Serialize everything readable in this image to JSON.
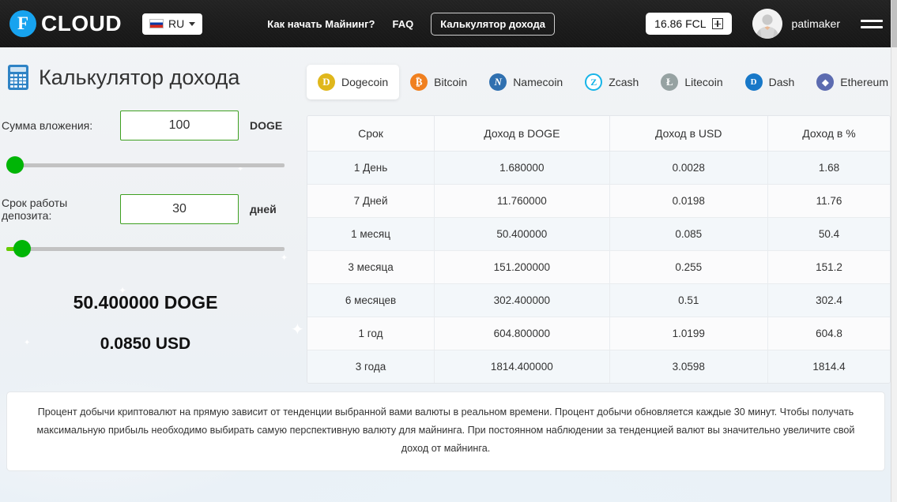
{
  "header": {
    "logo_letter": "F",
    "logo_text": "CLOUD",
    "lang": "RU",
    "lang_icon": "flag-ru-icon",
    "nav": [
      {
        "label": "Как начать Майнинг?",
        "type": "link"
      },
      {
        "label": "FAQ",
        "type": "link"
      },
      {
        "label": "Калькулятор дохода",
        "type": "button"
      }
    ],
    "balance": "16.86 FCL",
    "balance_add_icon": "plus-square-icon",
    "username": "patimaker",
    "avatar_icon": "user-avatar-icon",
    "menu_icon": "hamburger-menu-icon"
  },
  "calculator": {
    "icon": "calculator-icon",
    "title": "Калькулятор дохода",
    "amount": {
      "label": "Сумма вложения:",
      "value": "100",
      "unit": "DOGE",
      "slider_percent": 0
    },
    "term": {
      "label": "Срок работы депозита:",
      "value": "30",
      "unit": "дней",
      "slider_percent": 3
    },
    "result_coin": "50.400000 DOGE",
    "result_usd": "0.0850 USD"
  },
  "coins": [
    {
      "label": "Dogecoin",
      "symbol": "D",
      "color": "#e0b71b",
      "active": true
    },
    {
      "label": "Bitcoin",
      "symbol": "Ƀ",
      "color": "#f08020",
      "active": false
    },
    {
      "label": "Namecoin",
      "symbol": "ɴ",
      "color": "#3070b0",
      "active": false
    },
    {
      "label": "Zcash",
      "symbol": "Ⓩ",
      "color": "#16b4e8",
      "active": false
    },
    {
      "label": "Litecoin",
      "symbol": "Ł",
      "color": "#96a2a2",
      "active": false
    },
    {
      "label": "Dash",
      "symbol": "Ⓓ",
      "color": "#1878c8",
      "active": false
    },
    {
      "label": "Ethereum",
      "symbol": "◆",
      "color": "#5c6bb0",
      "active": false
    }
  ],
  "table": {
    "headers": [
      "Срок",
      "Доход в DOGE",
      "Доход в USD",
      "Доход в %"
    ],
    "rows": [
      [
        "1 День",
        "1.680000",
        "0.0028",
        "1.68"
      ],
      [
        "7 Дней",
        "11.760000",
        "0.0198",
        "11.76"
      ],
      [
        "1 месяц",
        "50.400000",
        "0.085",
        "50.4"
      ],
      [
        "3 месяца",
        "151.200000",
        "0.255",
        "151.2"
      ],
      [
        "6 месяцев",
        "302.400000",
        "0.51",
        "302.4"
      ],
      [
        "1 год",
        "604.800000",
        "1.0199",
        "604.8"
      ],
      [
        "3 года",
        "1814.400000",
        "3.0598",
        "1814.4"
      ]
    ]
  },
  "note": "Процент добычи криптовалют на прямую зависит от тенденции выбранной вами валюты в реальном времени. Процент добычи обновляется каждые 30 минут. Чтобы получать максимальную прибыль необходимо выбирать самую перспективную валюту для майнинга. При постоянном наблюдении за тенденцией валют вы значительно увеличите свой доход от майнинга.",
  "colors": {
    "header_bg": "#1c1c1c",
    "accent_blue": "#17a3ef",
    "input_border_green": "#3ea021",
    "slider_green": "#00b506",
    "page_bg": "#eef1f4"
  }
}
